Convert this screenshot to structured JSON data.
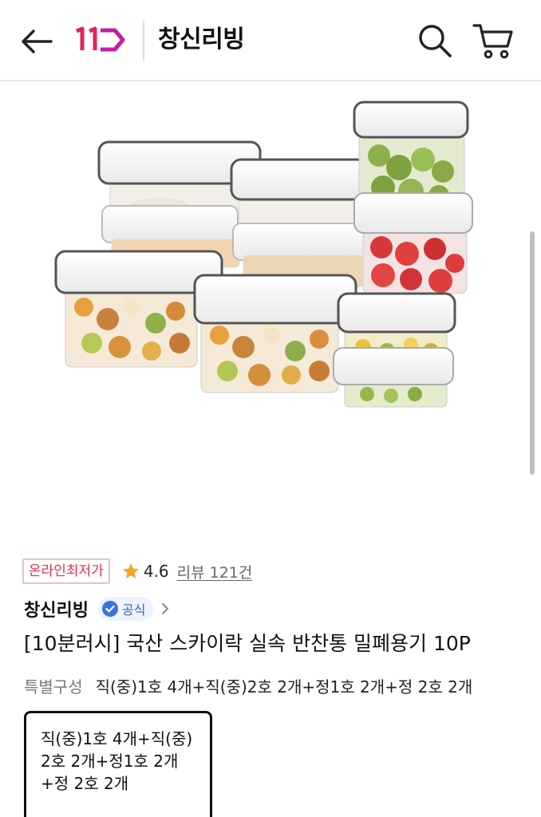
{
  "header": {
    "store_title": "창신리빙"
  },
  "product": {
    "price_badge": "온라인최저가",
    "rating": "4.6",
    "review_link": "리뷰 121건",
    "brand": "창신리빙",
    "official_badge": "공식",
    "name": "[10분러시] 국산 스카이락 실속 반찬통 밀폐용기 10P",
    "option_label": "특별구성",
    "option_value": "직(중)1호 4개+직(중)2호 2개+정1호 2개+정 2호 2개",
    "selected_option": "직(중)1호 4개+직(중)2호 2개+정1호 2개+정 2호 2개"
  },
  "colors": {
    "brand_accent": "#e0314b",
    "star": "#f5a623",
    "official_blue": "#2b63c8"
  }
}
